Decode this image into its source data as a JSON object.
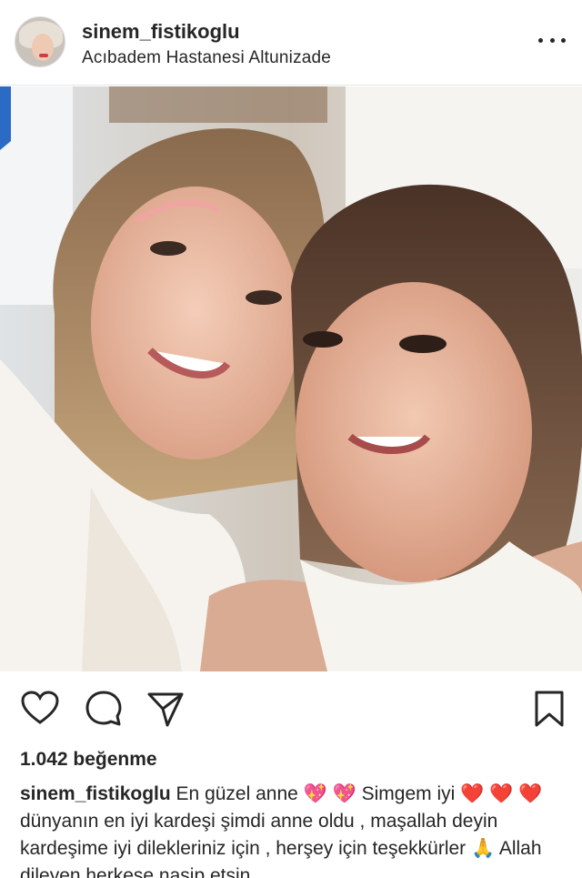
{
  "post": {
    "username": "sinem_fistikoglu",
    "location": "Acıbadem Hastanesi Altunizade"
  },
  "actions": {
    "like_icon": "heart-icon",
    "comment_icon": "comment-icon",
    "share_icon": "send-icon",
    "save_icon": "bookmark-icon"
  },
  "likes": "1.042 beğenme",
  "caption": {
    "username": "sinem_fistikoglu",
    "text": "En güzel anne 💖 💖 Simgem iyi ❤️ ❤️ ❤️ dünyanın en iyi kardeşi şimdi anne oldu , maşallah deyin kardeşime iyi dilekleriniz için , herşey için teşekkürler 🙏 Allah dileyen herkese nasip etsin"
  },
  "colors": {
    "text": "#262626",
    "divider": "#e6e6e6"
  }
}
